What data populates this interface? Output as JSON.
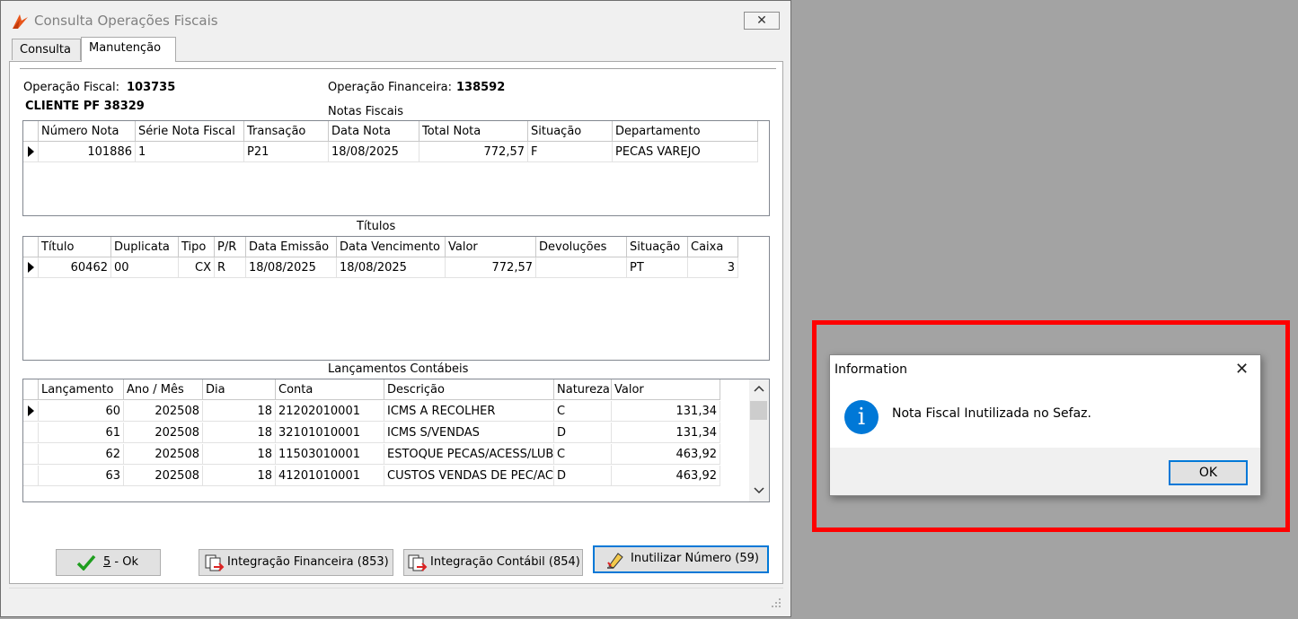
{
  "window": {
    "title": "Consulta Operações Fiscais",
    "close_glyph": "✕",
    "tabs": [
      {
        "label": "Consulta",
        "active": false
      },
      {
        "label": "Manutenção",
        "active": true
      }
    ]
  },
  "header": {
    "op_fiscal_label": "Operação Fiscal:",
    "op_fiscal_value": "103735",
    "client": "CLIENTE PF 38329",
    "op_fin_label": "Operação Financeira:",
    "op_fin_value": "138592"
  },
  "notas": {
    "title": "Notas Fiscais",
    "columns": [
      "Número Nota",
      "Série Nota Fiscal",
      "Transação",
      "Data Nota",
      "Total Nota",
      "Situação",
      "Departamento"
    ],
    "rows": [
      [
        "101886",
        "1",
        "P21",
        "18/08/2025",
        "772,57",
        "F",
        "PECAS VAREJO"
      ]
    ]
  },
  "titulos": {
    "title": "Títulos",
    "columns": [
      "Título",
      "Duplicata",
      "Tipo",
      "P/R",
      "Data Emissão",
      "Data Vencimento",
      "Valor",
      "Devoluções",
      "Situação",
      "Caixa"
    ],
    "rows": [
      [
        "60462",
        "00",
        "CX",
        "R",
        "18/08/2025",
        "18/08/2025",
        "772,57",
        "",
        "PT",
        "3"
      ]
    ]
  },
  "lancamentos": {
    "title": "Lançamentos Contábeis",
    "columns": [
      "Lançamento",
      "Ano / Mês",
      "Dia",
      "Conta",
      "Descrição",
      "Natureza",
      "Valor"
    ],
    "rows": [
      [
        "60",
        "202508",
        "18",
        "21202010001",
        "ICMS A RECOLHER",
        "C",
        "131,34"
      ],
      [
        "61",
        "202508",
        "18",
        "32101010001",
        "ICMS S/VENDAS",
        "D",
        "131,34"
      ],
      [
        "62",
        "202508",
        "18",
        "11503010001",
        "ESTOQUE PECAS/ACESS/LUB",
        "C",
        "463,92"
      ],
      [
        "63",
        "202508",
        "18",
        "41201010001",
        "CUSTOS VENDAS DE PEC/AC",
        "D",
        "463,92"
      ]
    ]
  },
  "buttons": {
    "ok_hotkey": "5",
    "ok_label": " - Ok",
    "integracao_financeira": "Integração Financeira (853)",
    "integracao_contabil": "Integração Contábil (854)",
    "inutilizar": "Inutilizar Número (59)"
  },
  "dialog": {
    "title": "Information",
    "close_glyph": "✕",
    "message": "Nota Fiscal Inutilizada no Sefaz.",
    "info_glyph": "i",
    "ok_label": "OK"
  },
  "colors": {
    "highlight_frame": "#ff0000",
    "info_icon": "#0078d7",
    "focus_border": "#0078d7"
  }
}
